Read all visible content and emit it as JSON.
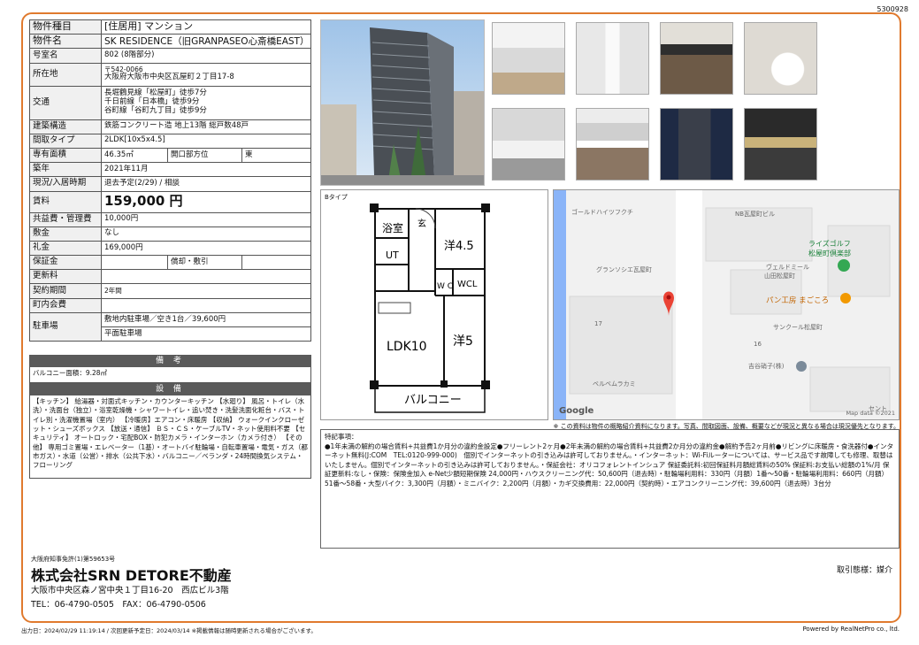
{
  "doc_id": "5300928",
  "info": {
    "type_label": "物件種目",
    "type_value": "[住居用] マンション",
    "name_label": "物件名",
    "name_value": "SK RESIDENCE（旧GRANPASEO心斎橋EAST）",
    "room_label": "号室名",
    "room_value": "802 (8階部分)",
    "addr_label": "所在地",
    "zip": "〒542-0066",
    "addr_value": "大阪府大阪市中央区瓦屋町２丁目17-8",
    "traffic_label": "交通",
    "traffic": [
      "長堀鶴見線「松屋町」徒歩7分",
      "千日前線「日本橋」徒歩9分",
      "谷町線「谷町九丁目」徒歩9分"
    ],
    "struct_label": "建築構造",
    "struct_value": "鉄筋コンクリート造 地上13階 総戸数48戸",
    "layout_label": "間取タイプ",
    "layout_value": "2LDK[10x5x4.5]",
    "area_label": "専有面積",
    "area_value": "46.35㎡",
    "dir_label": "開口部方位",
    "dir_value": "東",
    "built_label": "築年",
    "built_value": "2021年11月",
    "status_label": "現況/入居時期",
    "status_value": "退去予定(2/29) / 相談",
    "rent_label": "賃料",
    "rent_value": "159,000 円",
    "fee_label": "共益費・管理費",
    "fee_value": "10,000円",
    "key_label": "敷金",
    "key_value": "なし",
    "reikin_label": "礼金",
    "reikin_value": "169,000円",
    "deposit_label": "保証金",
    "shokyaku_label": "償却・敷引",
    "renew_label": "更新料",
    "contract_label": "契約期間",
    "contract_value": "2年間",
    "town_label": "町内会費",
    "parking_label": "駐車場",
    "parking_1": "敷地内駐車場／空き1台／39,600円",
    "parking_2": "平面駐車場"
  },
  "biko": {
    "title": "備 考",
    "text": "バルコニー面積：9.28㎡"
  },
  "setsubi": {
    "title": "設 備",
    "text": "【キッチン】 給湯器・対面式キッチン・カウンターキッチン 【水廻り】 風呂・トイレ（水洗）・洗面台（独立）・浴室乾燥機・シャワートイレ・追い焚き・洗髪洗面化粧台・バス・トイレ別・洗濯機置場（室内） 【冷暖房】エアコン・床暖房 【収納】 ウォークインクローゼット・シューズボックス 【放送・通信】 ＢＳ・ＣＳ・ケーブルTV・ネット使用料不要 【セキュリティ】 オートロック・宅配BOX・防犯カメラ・インターホン（カメラ付き） 【その他】 専用ゴミ置場・エレベーター（1基）・オートバイ駐輪場・自転車置場・電気・ガス（都市ガス）・水道（公営）・排水（公共下水）・バルコニー／ベランダ・24時間換気システム・フローリング"
  },
  "floorplan": {
    "type": "Bタイプ",
    "rooms": {
      "bath": "浴室",
      "ut": "UT",
      "genkan": "玄",
      "western1": "洋4.5",
      "wc": "W\nC",
      "wcl": "WCL",
      "ldk": "LDK10",
      "western2": "洋5",
      "balcony": "バルコニー"
    }
  },
  "map": {
    "labels": [
      "ゴールドハイツフクチ",
      "NB瓦屋町ビル",
      "ライズゴルフ",
      "松屋町倶楽部",
      "グランソシエ瓦屋町",
      "ヴェルドミール",
      "山田松屋町",
      "パン工房 まごころ",
      "17",
      "サンクール松屋町",
      "16",
      "吉谷硝子(株)",
      "ベルベムラカミ",
      "セント"
    ],
    "google": "Google",
    "credit": "Map data ©2021"
  },
  "note": "※ この資料は物件の概略紹介資料になります。写真、間取図面、設備、概要などが現況と異なる場合は現況優先となります。",
  "remarks": {
    "title": "特記事項：",
    "text": "●1年未満の解約の場合賃料+共益費1か月分の違約金設定●フリーレント2ヶ月●2年未満の解約の場合賃料+共益費2か月分の違約金●解約予告2ヶ月前●リビングに床暖房・食洗器付●インターネット無料(J:COM　TEL:0120-999-000)　個別でインターネットの引き込みは許可しておりません。・インターネット：Wi-Fiルーターについては、サービス品です故障しても修理、取替はいたしません。個別でインターネットの引き込みは許可しておりません。・保証会社：オリコフォレントインシュア 保証委託料:初回保証料月額総賃料の50% 保証料:お支払い総額の1%/月 保証更新料:なし・保険：保険金加入 e-Net少額短期保険 24,000円・ハウスクリーニング代：50,600円（退去時）・駐輪場利用料：330円（月額）1番〜50番・駐輪場利用料：660円（月額）51番〜58番・大型バイク：3,300円（月額）・ミニバイク：2,200円（月額）・カギ交換費用：22,000円（契約時）・エアコンクリーニング代：39,600円（退去時）3台分"
  },
  "company": {
    "license": "大阪府知事免許(1)第59653号",
    "name": "株式会社SRN DETORE不動産",
    "address": "大阪市中央区森ノ宮中央１丁目16-20　西広ビル3階",
    "tel": "TEL：06-4790-0505　FAX：06-4790-0506",
    "torihiki": "取引態様：媒介"
  },
  "footer": {
    "left": "出力日：2024/02/29 11:19:14 / 次回更新予定日：2024/03/14 ※掲載情報は随時更新される場合がございます。",
    "right": "Powered by RealNetPro co., ltd."
  }
}
